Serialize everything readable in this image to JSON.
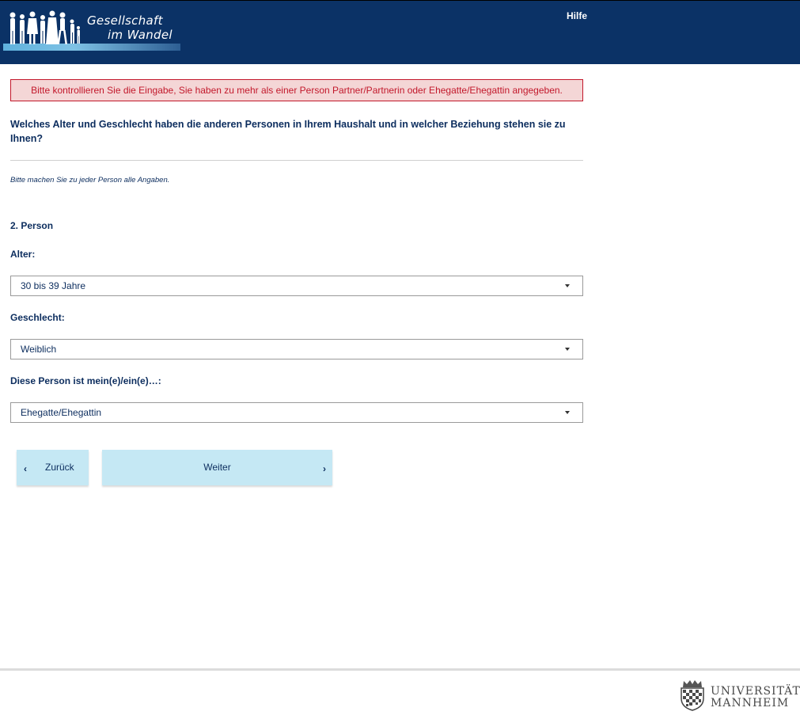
{
  "header": {
    "logo_line1": "Gesellschaft",
    "logo_line2": "im Wandel",
    "help_label": "Hilfe"
  },
  "alert": {
    "message": "Bitte kontrollieren Sie die Eingabe, Sie haben zu mehr als einer Person Partner/Partnerin oder Ehegatte/Ehegattin angegeben."
  },
  "question": {
    "text": "Welches Alter und Geschlecht haben die anderen Personen in Ihrem Haushalt und in welcher Beziehung stehen sie zu Ihnen?",
    "instruction": "Bitte machen Sie zu jeder Person alle Angaben."
  },
  "person": {
    "title": "2. Person",
    "age_label": "Alter:",
    "age_value": "30 bis 39 Jahre",
    "gender_label": "Geschlecht:",
    "gender_value": "Weiblich",
    "relation_label": "Diese Person ist mein(e)/ein(e)…:",
    "relation_value": "Ehegatte/Ehegattin"
  },
  "nav": {
    "back_label": "Zurück",
    "next_label": "Weiter"
  },
  "footer": {
    "uni_line1": "UNIVERSITÄT",
    "uni_line2": "MANNHEIM"
  },
  "colors": {
    "header_bg": "#0b3266",
    "alert_bg": "#f4d6d6",
    "alert_text": "#c2182b",
    "text_primary": "#0c2d5e",
    "button_bg": "#c5e8f4"
  },
  "icons": {
    "logo_figures": "people-silhouettes-icon",
    "back": "chevron-left-icon",
    "next": "chevron-right-icon",
    "dropdown": "caret-down-icon",
    "uni_seal": "university-seal-icon"
  }
}
